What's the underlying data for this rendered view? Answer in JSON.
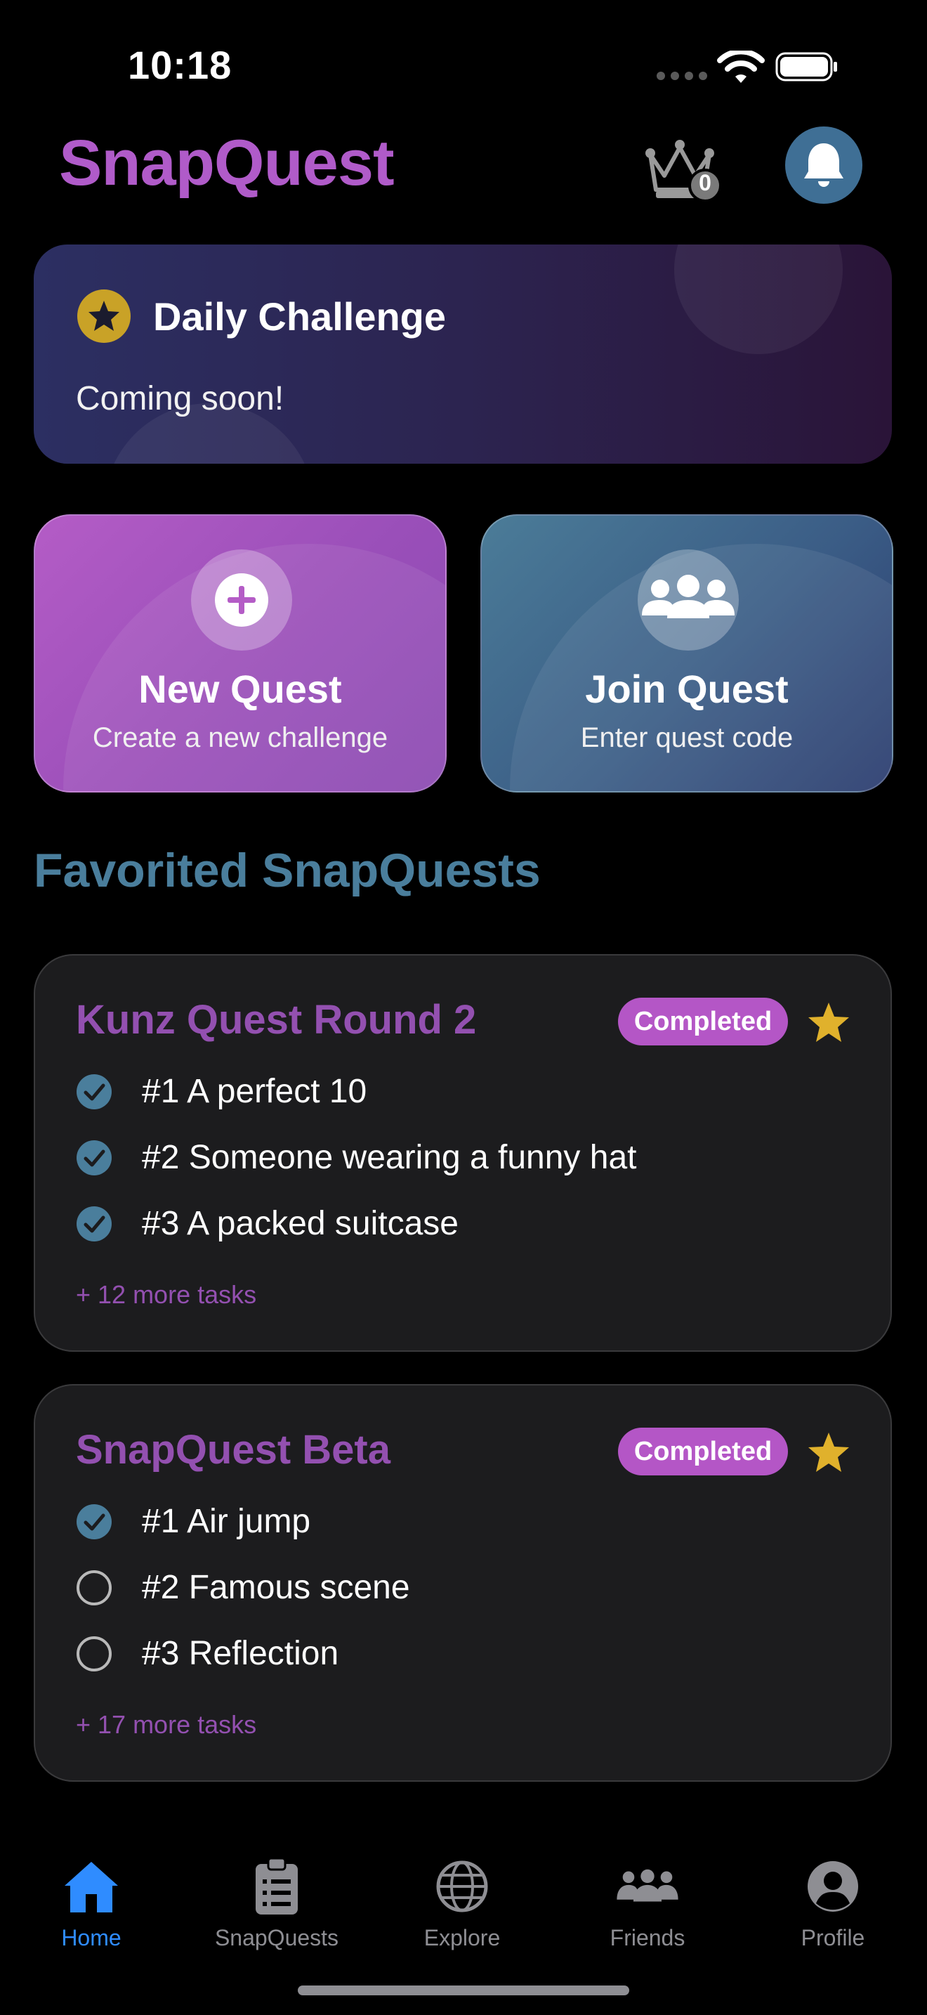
{
  "status_bar": {
    "time": "10:18"
  },
  "header": {
    "title": "SnapQuest",
    "crown_count": "0"
  },
  "daily_challenge": {
    "title": "Daily Challenge",
    "subtitle": "Coming soon!"
  },
  "actions": {
    "new_quest": {
      "title": "New Quest",
      "subtitle": "Create a new challenge"
    },
    "join_quest": {
      "title": "Join Quest",
      "subtitle": "Enter quest code"
    }
  },
  "favorites": {
    "title": "Favorited SnapQuests",
    "quests": [
      {
        "name": "Kunz Quest Round 2",
        "badge": "Completed",
        "tasks": [
          {
            "label": "#1 A perfect 10",
            "done": true
          },
          {
            "label": "#2 Someone wearing a funny hat",
            "done": true
          },
          {
            "label": "#3 A packed suitcase",
            "done": true
          }
        ],
        "more": "+ 12 more tasks"
      },
      {
        "name": "SnapQuest Beta",
        "badge": "Completed",
        "tasks": [
          {
            "label": "#1 Air jump",
            "done": true
          },
          {
            "label": "#2 Famous scene",
            "done": false
          },
          {
            "label": "#3 Reflection",
            "done": false
          }
        ],
        "more": "+ 17 more tasks"
      }
    ]
  },
  "tabs": [
    {
      "label": "Home",
      "icon": "house-icon",
      "active": true
    },
    {
      "label": "SnapQuests",
      "icon": "clipboard-icon",
      "active": false
    },
    {
      "label": "Explore",
      "icon": "globe-icon",
      "active": false
    },
    {
      "label": "Friends",
      "icon": "people-icon",
      "active": false
    },
    {
      "label": "Profile",
      "icon": "person-circle-icon",
      "active": false
    }
  ],
  "colors": {
    "brand_purple": "#b05bc9",
    "accent_blue": "#4a7e9c",
    "badge": "#b456c6",
    "tab_active": "#2f8cff",
    "star_gold": "#e0b12c"
  }
}
